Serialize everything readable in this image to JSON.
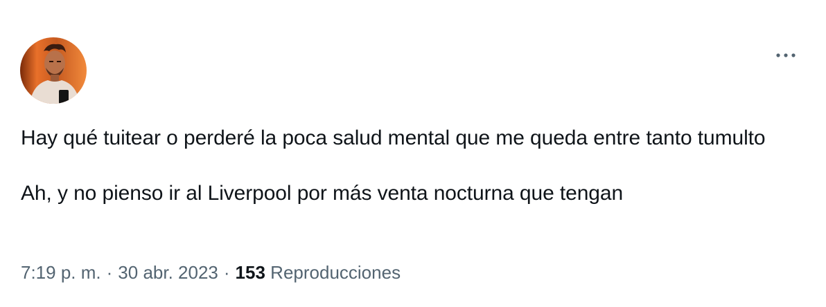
{
  "tweet": {
    "paragraph_1": "Hay qué tuitear o perderé la poca salud mental que me queda entre tanto tumulto",
    "paragraph_2": "Ah, y no pienso ir al Liverpool por más venta nocturna que tengan"
  },
  "meta": {
    "time": "7:19 p. m.",
    "separator": "·",
    "date": "30 abr. 2023",
    "views_count": "153",
    "views_label": "Reproducciones"
  },
  "icons": {
    "more": "more-horizontal-icon"
  },
  "colors": {
    "text_primary": "#0f1419",
    "text_secondary": "#536471",
    "background": "#ffffff"
  }
}
